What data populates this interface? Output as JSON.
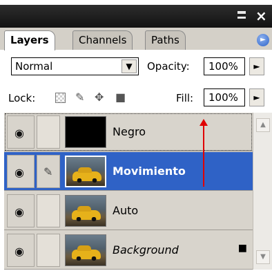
{
  "window": {
    "minimize_glyph": "",
    "close_glyph": "×"
  },
  "tabs": [
    {
      "label": "Layers",
      "active": true
    },
    {
      "label": "Channels",
      "active": false
    },
    {
      "label": "Paths",
      "active": false
    }
  ],
  "panel_menu_icon": "►",
  "blend_mode": {
    "value": "Normal",
    "dropdown_icon": "▼"
  },
  "opacity": {
    "label": "Opacity:",
    "value": "100%",
    "arrow_icon": "►"
  },
  "lock": {
    "label": "Lock:",
    "icons": [
      "transparency-lock-icon",
      "brush-lock-icon",
      "move-lock-icon",
      "padlock-icon"
    ]
  },
  "fill": {
    "label": "Fill:",
    "value": "100%",
    "arrow_icon": "►"
  },
  "layers": [
    {
      "name": "Negro",
      "thumbnail": "black",
      "selected": false,
      "linked": false
    },
    {
      "name": "Movimiento",
      "thumbnail": "car-photo",
      "selected": true,
      "linked": true
    },
    {
      "name": "Auto",
      "thumbnail": "car-photo",
      "selected": false,
      "linked": false
    },
    {
      "name": "Background",
      "thumbnail": "car-photo",
      "selected": false,
      "linked": false,
      "locked": true
    }
  ],
  "colors": {
    "selection": "#2f62c6",
    "annotation_arrow": "#e00000"
  }
}
